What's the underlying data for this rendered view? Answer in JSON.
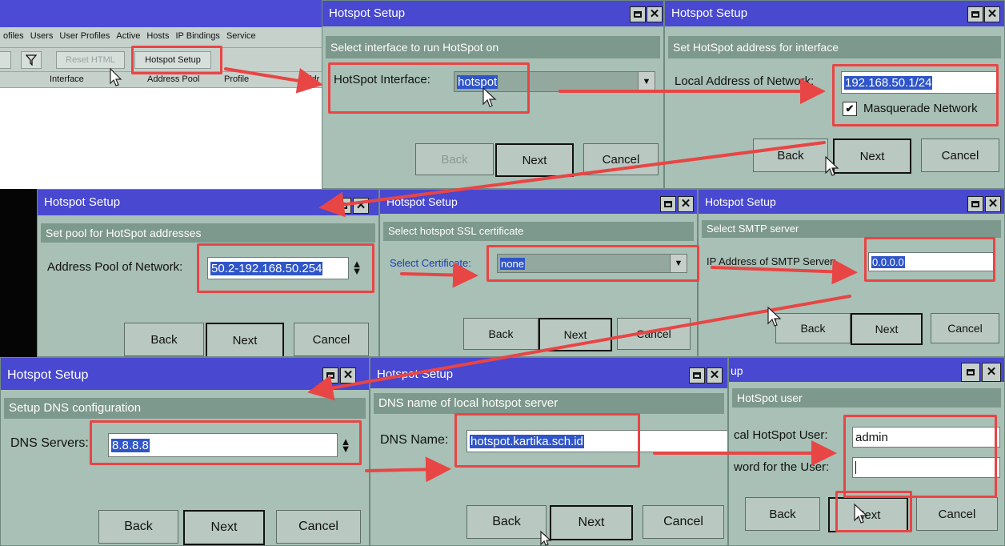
{
  "list_window": {
    "tabs": [
      "ofiles",
      "Users",
      "User Profiles",
      "Active",
      "Hosts",
      "IP Bindings",
      "Service"
    ],
    "filter_icon": "filter-icon",
    "reset_html_label": "Reset HTML",
    "hotspot_setup_label": "Hotspot Setup",
    "columns": [
      "Interface",
      "Address Pool",
      "Profile",
      "Addr"
    ]
  },
  "dialog_title": "Hotspot Setup",
  "buttons": {
    "back": "Back",
    "next": "Next",
    "cancel": "Cancel"
  },
  "step1": {
    "subtitle": "Select interface to run HotSpot on",
    "label": "HotSpot Interface:",
    "value": "hotspot"
  },
  "step2": {
    "subtitle": "Set HotSpot address for interface",
    "label": "Local Address of Network:",
    "value": "192.168.50.1/24",
    "checkbox_label": "Masquerade Network",
    "checkbox_checked": true
  },
  "step3": {
    "subtitle": "Set pool for HotSpot addresses",
    "label": "Address Pool of Network:",
    "value": "50.2-192.168.50.254"
  },
  "step4": {
    "title": "Hotspot Setup",
    "subtitle": "Select hotspot SSL certificate",
    "label": "Select Certificate:",
    "value": "none"
  },
  "step5": {
    "subtitle": "Select SMTP server",
    "label": "IP Address of SMTP Server:",
    "value": "0.0.0.0"
  },
  "step6": {
    "subtitle": "Setup DNS configuration",
    "label": "DNS Servers:",
    "value": "8.8.8.8"
  },
  "step7": {
    "subtitle": "DNS name of local hotspot server",
    "label": "DNS Name:",
    "value": "hotspot.kartika.sch.id"
  },
  "step8": {
    "title": "up",
    "subtitle": "HotSpot user",
    "user_label": "cal HotSpot User:",
    "user_value": "admin",
    "pass_label": "word for the User:",
    "pass_value": "",
    "next_label": "Next"
  },
  "colors": {
    "titlebar": "#4848d0",
    "panel": "#a8c0b5",
    "subheader": "#7d988c",
    "highlight": "#e84545"
  }
}
